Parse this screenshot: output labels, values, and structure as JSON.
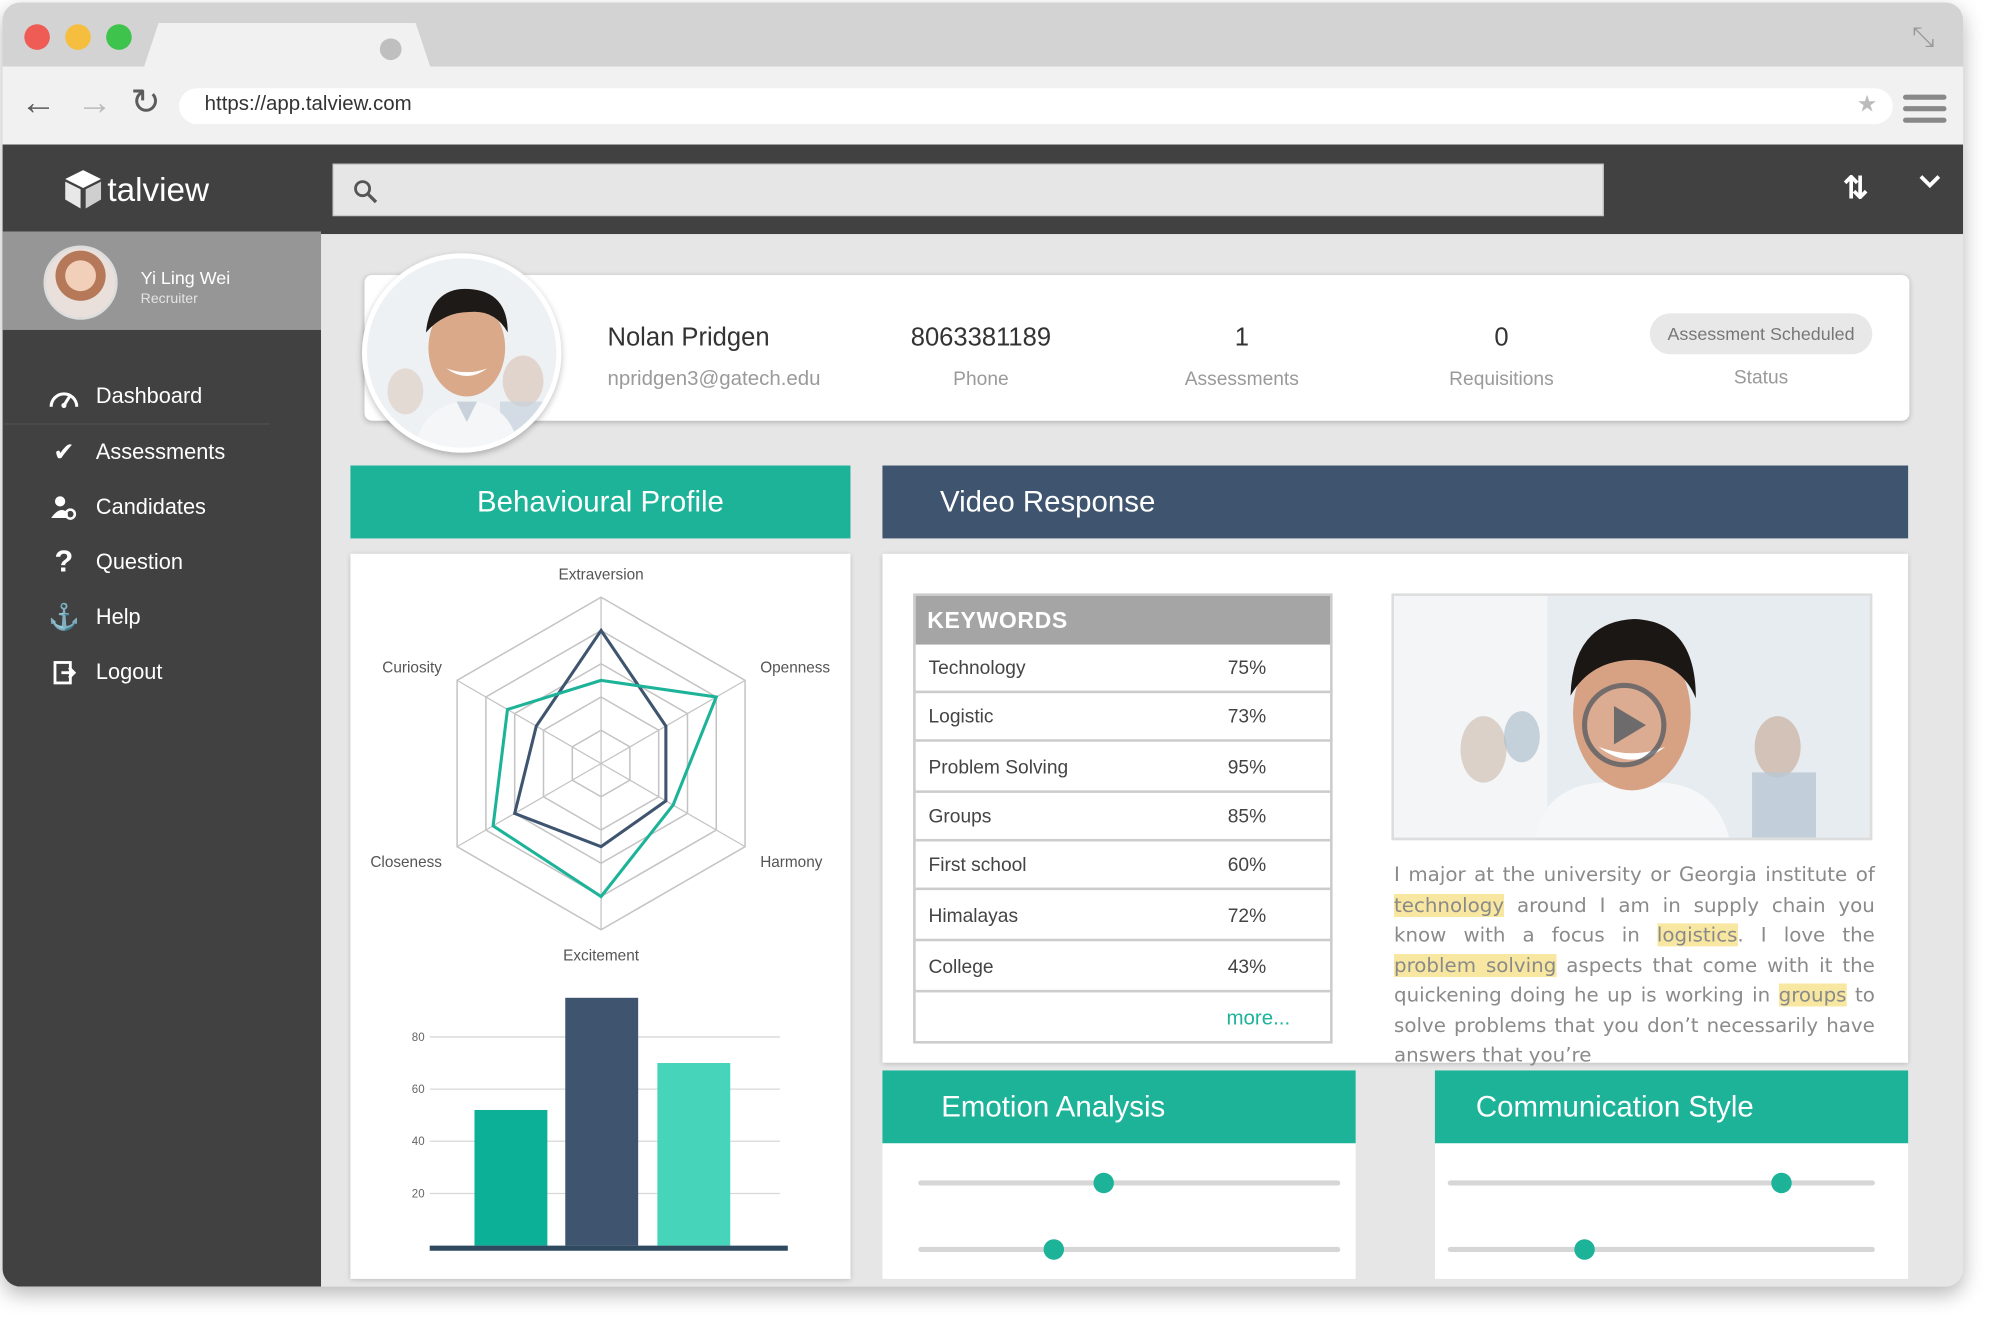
{
  "browser": {
    "url": "https://app.talview.com",
    "traffic_lights": [
      "#ee5c55",
      "#f5be3f",
      "#3ec34c"
    ]
  },
  "app": {
    "brand": "talview",
    "user": {
      "name": "Yi Ling Wei",
      "role": "Recruiter"
    },
    "menu": [
      {
        "label": "Dashboard",
        "icon": "dashboard-gauge-icon"
      },
      {
        "label": "Assessments",
        "icon": "checkmark-icon"
      },
      {
        "label": "Candidates",
        "icon": "person-settings-icon"
      },
      {
        "label": "Question",
        "icon": "question-mark-icon"
      },
      {
        "label": "Help",
        "icon": "anchor-icon"
      },
      {
        "label": "Logout",
        "icon": "logout-icon"
      }
    ],
    "search": {
      "placeholder": ""
    }
  },
  "candidate": {
    "name": "Nolan Pridgen",
    "email": "npridgen3@gatech.edu",
    "phone": "8063381189",
    "phone_label": "Phone",
    "assessments": "1",
    "assessments_label": "Assessments",
    "requisitions": "0",
    "requisitions_label": "Requisitions",
    "status": "Assessment Scheduled",
    "status_label": "Status"
  },
  "sections": {
    "behavioural": "Behavioural Profile",
    "video": "Video Response",
    "emotion": "Emotion Analysis",
    "communication": "Communication Style"
  },
  "keywords": {
    "header": "KEYWORDS",
    "rows": [
      {
        "keyword": "Technology",
        "percent": "75%"
      },
      {
        "keyword": "Logistic",
        "percent": "73%"
      },
      {
        "keyword": "Problem Solving",
        "percent": "95%"
      },
      {
        "keyword": "Groups",
        "percent": "85%"
      },
      {
        "keyword": "First school",
        "percent": "60%"
      },
      {
        "keyword": "Himalayas",
        "percent": "72%"
      },
      {
        "keyword": "College",
        "percent": "43%"
      }
    ],
    "more": "more..."
  },
  "transcript": {
    "segments": [
      {
        "text": "I major at the university or Georgia institute of ",
        "hl": false
      },
      {
        "text": "technology",
        "hl": true
      },
      {
        "text": " around I am in supply chain you know with a focus in ",
        "hl": false
      },
      {
        "text": "logistics",
        "hl": true
      },
      {
        "text": ". I love the ",
        "hl": false
      },
      {
        "text": "problem solving",
        "hl": true
      },
      {
        "text": " aspects that come with it the quickening doing he up is working in ",
        "hl": false
      },
      {
        "text": "groups",
        "hl": true
      },
      {
        "text": " to solve problems that you don’t necessarily have answers that you’re",
        "hl": false
      }
    ],
    "highlight_color": "#f8e7a0"
  },
  "emotion_sliders": [
    0.44,
    0.32
  ],
  "communication_sliders": [
    0.78,
    0.32
  ],
  "chart_data": [
    {
      "type": "radar",
      "axes": [
        "Extraversion",
        "Openness",
        "Harmony",
        "Excitement",
        "Closeness",
        "Curiosity"
      ],
      "series": [
        {
          "values": [
            0.8,
            0.45,
            0.45,
            0.5,
            0.6,
            0.45
          ],
          "color": "#3e546f"
        },
        {
          "values": [
            0.5,
            0.8,
            0.5,
            0.8,
            0.75,
            0.65
          ],
          "color": "#1db399"
        }
      ],
      "rings": 5
    },
    {
      "type": "bar",
      "categories": [
        "",
        "",
        ""
      ],
      "values": [
        52,
        95,
        70
      ],
      "colors": [
        "#0bb096",
        "#3e546f",
        "#46d4bb"
      ],
      "yticks": [
        20,
        40,
        60,
        80
      ],
      "ylim": [
        0,
        100
      ]
    }
  ],
  "colors": {
    "teal": "#1db399",
    "navy": "#3e546f",
    "sidebar": "#414141"
  }
}
